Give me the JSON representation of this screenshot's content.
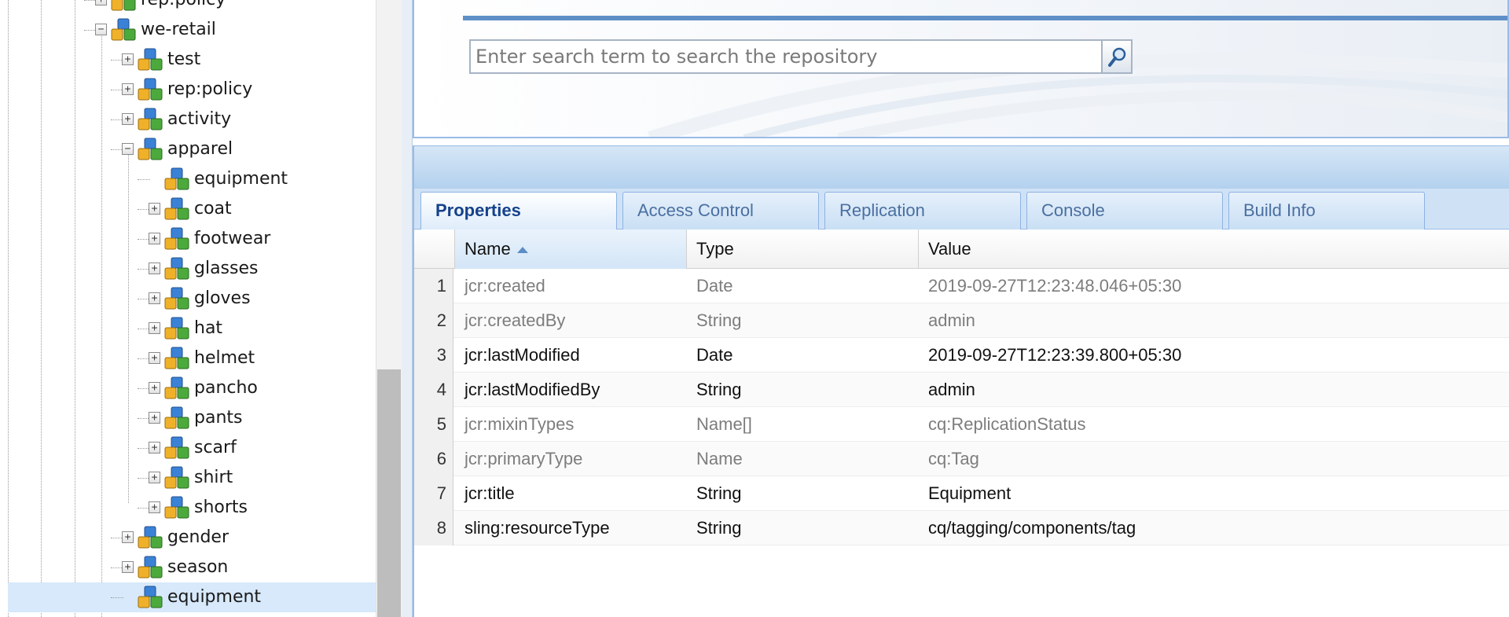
{
  "tree": {
    "nodes": [
      {
        "label": "rep:policy",
        "toggle": "+"
      },
      {
        "label": "we-retail",
        "toggle": "−"
      },
      {
        "label": "test",
        "toggle": "+"
      },
      {
        "label": "rep:policy",
        "toggle": "+"
      },
      {
        "label": "activity",
        "toggle": "+"
      },
      {
        "label": "apparel",
        "toggle": "−"
      },
      {
        "label": "equipment",
        "toggle": ""
      },
      {
        "label": "coat",
        "toggle": "+"
      },
      {
        "label": "footwear",
        "toggle": "+"
      },
      {
        "label": "glasses",
        "toggle": "+"
      },
      {
        "label": "gloves",
        "toggle": "+"
      },
      {
        "label": "hat",
        "toggle": "+"
      },
      {
        "label": "helmet",
        "toggle": "+"
      },
      {
        "label": "pancho",
        "toggle": "+"
      },
      {
        "label": "pants",
        "toggle": "+"
      },
      {
        "label": "scarf",
        "toggle": "+"
      },
      {
        "label": "shirt",
        "toggle": "+"
      },
      {
        "label": "shorts",
        "toggle": "+"
      },
      {
        "label": "gender",
        "toggle": "+"
      },
      {
        "label": "season",
        "toggle": "+"
      },
      {
        "label": "equipment",
        "toggle": ""
      }
    ],
    "selected_label": "equipment",
    "node_icon": "node-icon"
  },
  "search": {
    "placeholder": "Enter search term to search the repository",
    "button_icon": "search-icon"
  },
  "tabs": [
    {
      "label": "Properties",
      "active": true
    },
    {
      "label": "Access Control",
      "active": false
    },
    {
      "label": "Replication",
      "active": false
    },
    {
      "label": "Console",
      "active": false
    },
    {
      "label": "Build Info",
      "active": false
    }
  ],
  "grid": {
    "columns": [
      "Name",
      "Type",
      "Value"
    ],
    "sorted_column": "Name",
    "sort_direction": "ascending",
    "rows": [
      {
        "num": "1",
        "name": "jcr:created",
        "type": "Date",
        "value": "2019-09-27T12:23:48.046+05:30",
        "protected": true
      },
      {
        "num": "2",
        "name": "jcr:createdBy",
        "type": "String",
        "value": "admin",
        "protected": true
      },
      {
        "num": "3",
        "name": "jcr:lastModified",
        "type": "Date",
        "value": "2019-09-27T12:23:39.800+05:30",
        "protected": false
      },
      {
        "num": "4",
        "name": "jcr:lastModifiedBy",
        "type": "String",
        "value": "admin",
        "protected": false
      },
      {
        "num": "5",
        "name": "jcr:mixinTypes",
        "type": "Name[]",
        "value": "cq:ReplicationStatus",
        "protected": true
      },
      {
        "num": "6",
        "name": "jcr:primaryType",
        "type": "Name",
        "value": "cq:Tag",
        "protected": true
      },
      {
        "num": "7",
        "name": "jcr:title",
        "type": "String",
        "value": "Equipment",
        "protected": false
      },
      {
        "num": "8",
        "name": "sling:resourceType",
        "type": "String",
        "value": "cq/tagging/components/tag",
        "protected": false
      }
    ]
  },
  "colors": {
    "accent": "#15428b",
    "selection": "#d7e9fb",
    "panel_border": "#99bbe8"
  }
}
